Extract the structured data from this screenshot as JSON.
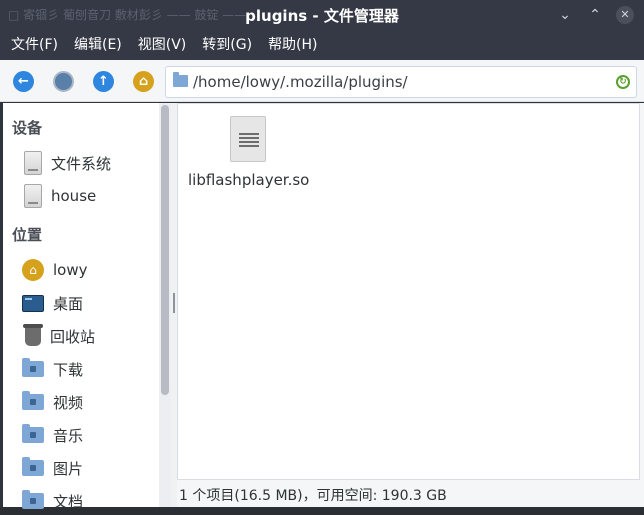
{
  "window": {
    "title": "plugins - 文件管理器",
    "ghost_text": "□ 寄锢彡  葡刨音刀  敷材彭彡        ——  鼓锭 ——",
    "controls": {
      "minimize": "⌄",
      "maximize": "⌃",
      "close": "✕"
    }
  },
  "menubar": {
    "items": [
      "文件(F)",
      "编辑(E)",
      "视图(V)",
      "转到(G)",
      "帮助(H)"
    ]
  },
  "toolbar": {
    "back_icon": "arrow-left-icon",
    "forward_icon": "forward-icon",
    "up_icon": "arrow-up-icon",
    "home_icon": "home-icon",
    "address": "/home/lowy/.mozilla/plugins/",
    "refresh_icon": "refresh-icon"
  },
  "sidebar": {
    "devices_heading": "设备",
    "devices": [
      {
        "label": "文件系统",
        "icon": "drive-icon"
      },
      {
        "label": "house",
        "icon": "drive-icon"
      }
    ],
    "places_heading": "位置",
    "places": [
      {
        "label": "lowy",
        "icon": "home-folder-icon"
      },
      {
        "label": "桌面",
        "icon": "desktop-icon"
      },
      {
        "label": "回收站",
        "icon": "trash-icon"
      },
      {
        "label": "下载",
        "icon": "download-folder-icon"
      },
      {
        "label": "视频",
        "icon": "video-folder-icon"
      },
      {
        "label": "音乐",
        "icon": "music-folder-icon"
      },
      {
        "label": "图片",
        "icon": "pictures-folder-icon"
      },
      {
        "label": "文档",
        "icon": "documents-folder-icon"
      }
    ]
  },
  "files": [
    {
      "name": "libflashplayer.so",
      "icon": "shared-library-file-icon"
    }
  ],
  "statusbar": {
    "text": "1 个项目(16.5 MB)，可用空间: 190.3 GB"
  },
  "colors": {
    "titlebar": "#353945",
    "accent_blue": "#2e86de",
    "home_gold": "#d6a21e",
    "folder_blue": "#7fa7d6"
  }
}
